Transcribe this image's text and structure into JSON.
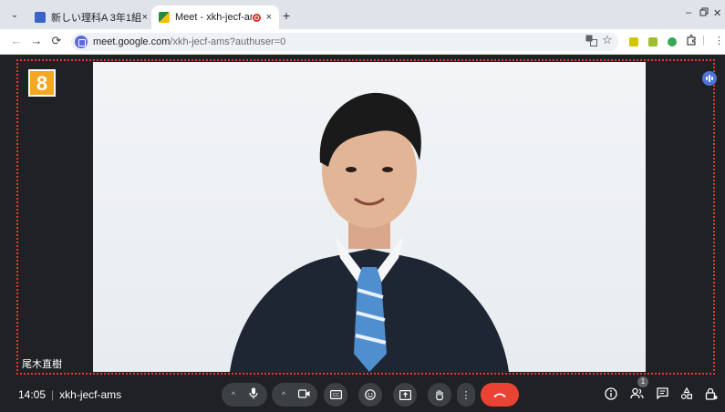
{
  "browser": {
    "tabs": [
      {
        "title": "新しい理科A 3年1組",
        "favicon_color": "#3b62c8"
      },
      {
        "title": "Meet - xkh-jecf-ams",
        "favicon_color": "#1e8e3e"
      }
    ],
    "close_glyph": "×",
    "new_tab_glyph": "+",
    "url_host": "meet.google.com",
    "url_path": "/xkh-jecf-ams?authuser=0",
    "window_controls": {
      "minimize": "–",
      "restore": "🗗",
      "close": "✕"
    }
  },
  "meet": {
    "tile_number": "8",
    "participant_name": "尾木直樹",
    "time": "14:05",
    "separator": "|",
    "meeting_code": "xkh-jecf-ams",
    "participants_count": "1",
    "accent": "#ea4335",
    "frame_color": "#e53935"
  }
}
